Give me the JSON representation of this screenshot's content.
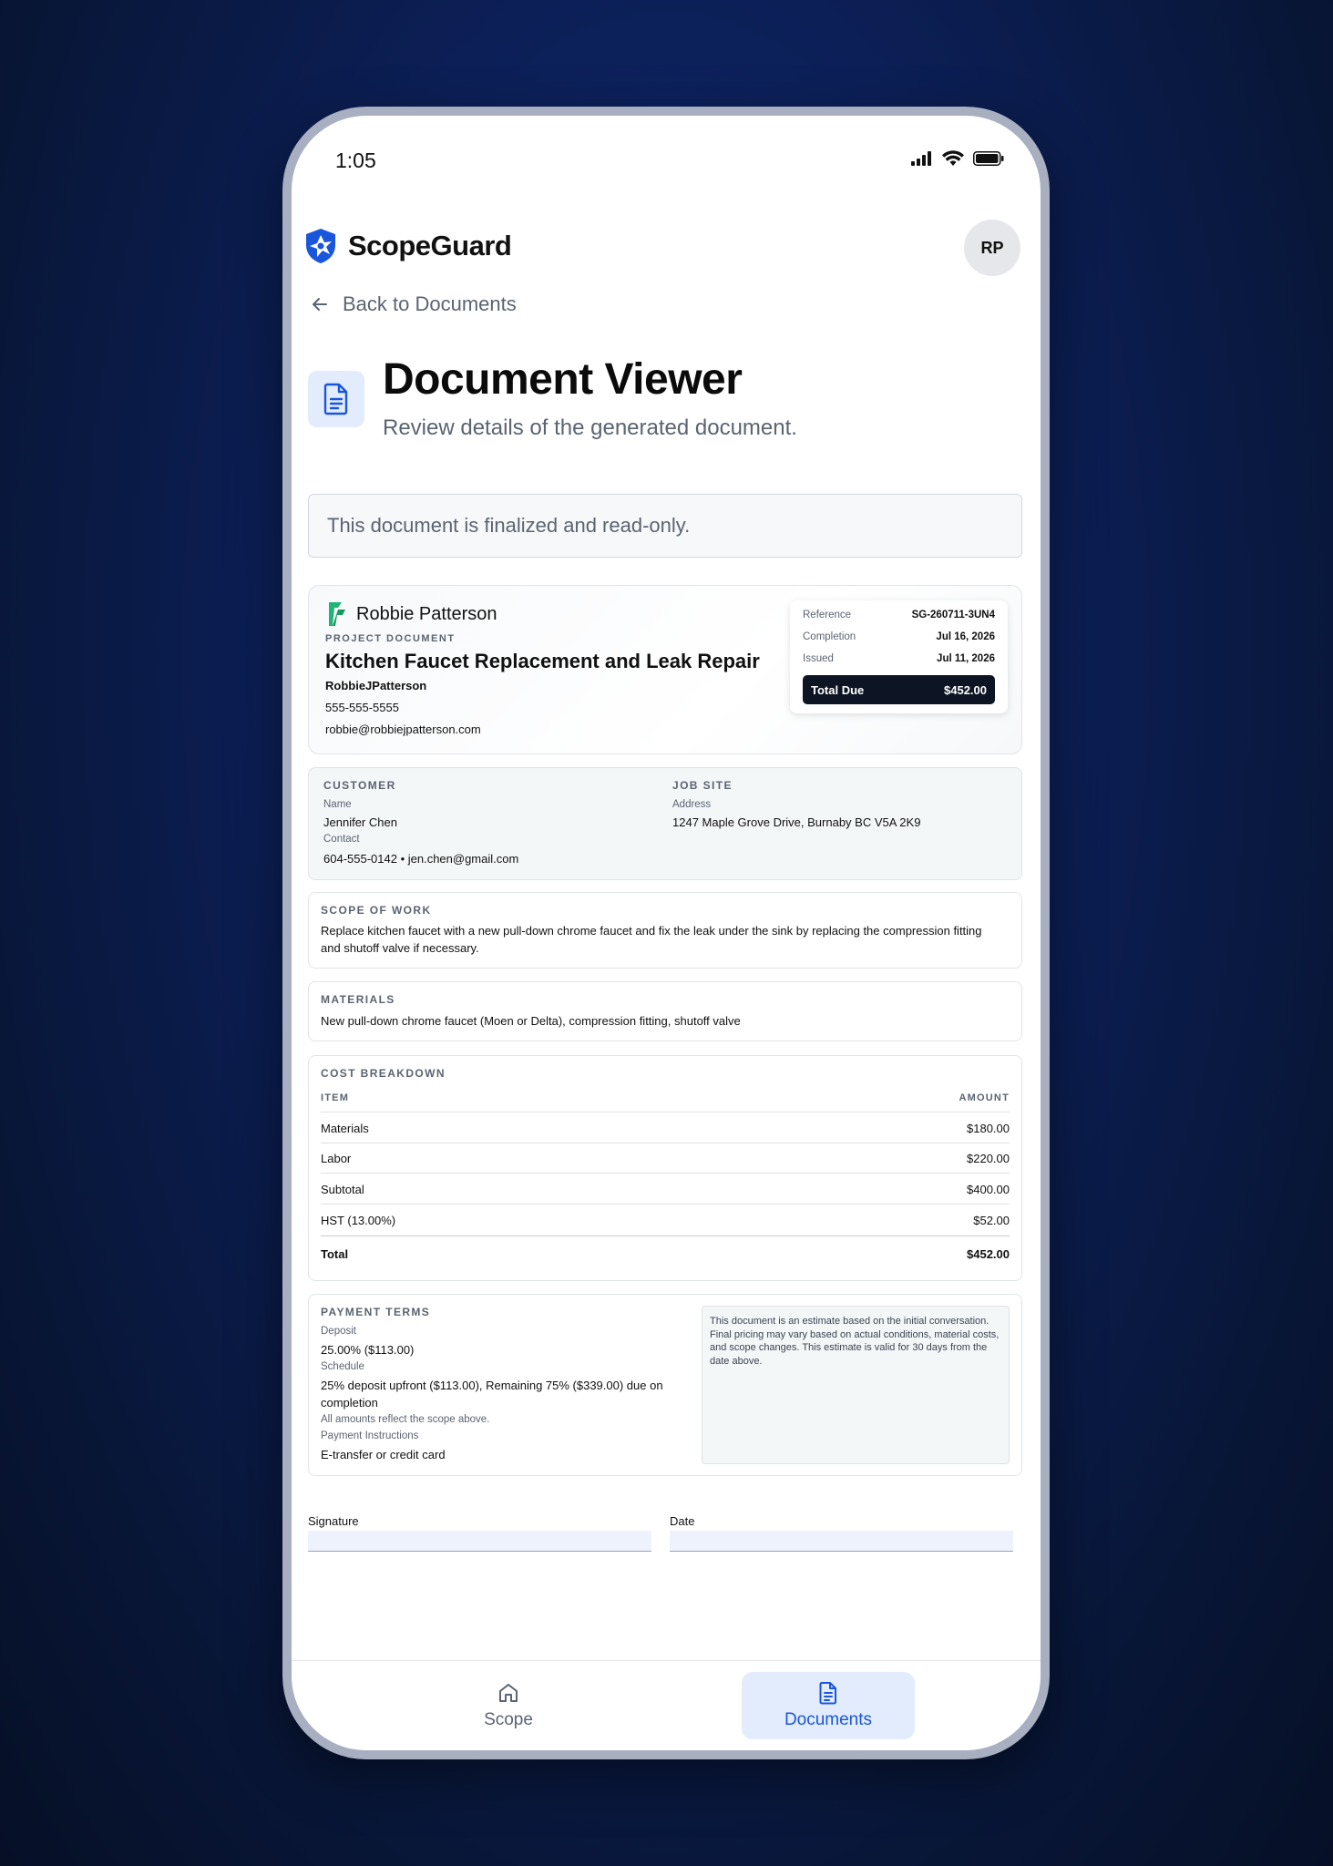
{
  "status_bar": {
    "time": "1:05"
  },
  "app": {
    "brand": "ScopeGuard",
    "avatar_initials": "RP"
  },
  "nav": {
    "back_label": "Back to Documents"
  },
  "page": {
    "title": "Document Viewer",
    "subtitle": "Review details of the generated document.",
    "notice": "This document is finalized and read-only."
  },
  "document": {
    "contractor_name": "Robbie Patterson",
    "section_label": "PROJECT DOCUMENT",
    "title": "Kitchen Faucet Replacement and Leak Repair",
    "contact_name": "RobbieJPatterson",
    "phone": "555-555-5555",
    "email": "robbie@robbiejpatterson.com",
    "meta": {
      "reference_label": "Reference",
      "reference": "SG-260711-3UN4",
      "completion_label": "Completion",
      "completion": "Jul 16, 2026",
      "issued_label": "Issued",
      "issued": "Jul 11, 2026",
      "total_due_label": "Total Due",
      "total_due": "$452.00"
    },
    "customer": {
      "label": "CUSTOMER",
      "name_label": "Name",
      "name": "Jennifer Chen",
      "contact_label": "Contact",
      "contact": "604-555-0142 • jen.chen@gmail.com"
    },
    "job_site": {
      "label": "JOB SITE",
      "address_label": "Address",
      "address": "1247 Maple Grove Drive, Burnaby BC V5A 2K9"
    },
    "scope": {
      "label": "SCOPE OF WORK",
      "line1": "Replace kitchen faucet with a new pull-down chrome faucet and fix the leak under the sink by replacing the compression fitting",
      "line2": "and shutoff valve if necessary."
    },
    "materials": {
      "label": "MATERIALS",
      "text": "New pull-down chrome faucet (Moen or Delta), compression fitting, shutoff valve"
    },
    "cost": {
      "label": "COST BREAKDOWN",
      "col_item": "ITEM",
      "col_amount": "AMOUNT",
      "rows": [
        {
          "item": "Materials",
          "amount": "$180.00"
        },
        {
          "item": "Labor",
          "amount": "$220.00"
        },
        {
          "item": "Subtotal",
          "amount": "$400.00"
        },
        {
          "item": "HST (13.00%)",
          "amount": "$52.00"
        }
      ],
      "total_label": "Total",
      "total": "$452.00"
    },
    "payment": {
      "label": "PAYMENT TERMS",
      "deposit_label": "Deposit",
      "deposit": "25.00% ($113.00)",
      "schedule_label": "Schedule",
      "schedule_line1": "25% deposit upfront ($113.00), Remaining 75% ($339.00) due on",
      "schedule_line2": "completion",
      "scope_note": "All amounts reflect the scope above.",
      "instructions_label": "Payment Instructions",
      "instructions": "E-transfer or credit card",
      "disclaimer_line1": "This document is an estimate based on the initial conversation.",
      "disclaimer_line2": "Final pricing may vary based on actual conditions, material costs,",
      "disclaimer_line3": "and scope changes. This estimate is valid for 30 days from the",
      "disclaimer_line4": "date above."
    },
    "signature_label": "Signature",
    "date_label": "Date"
  },
  "bottom_nav": {
    "scope_label": "Scope",
    "documents_label": "Documents"
  },
  "colors": {
    "accent": "#1a56db",
    "brand_green": "#1fb574",
    "dark": "#0d1423"
  }
}
